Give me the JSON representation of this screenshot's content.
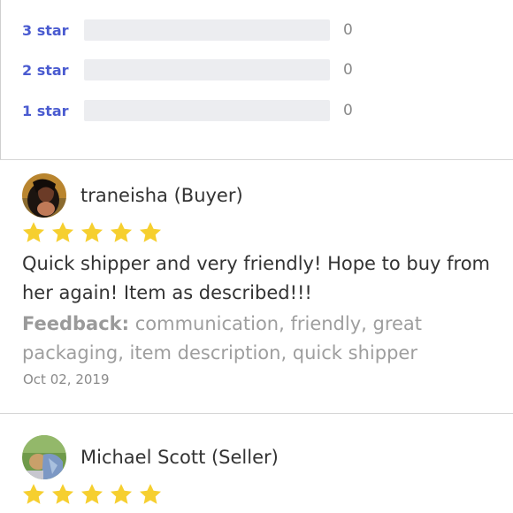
{
  "rating_breakdown": [
    {
      "label": "3 star",
      "count": "0",
      "fraction": 0
    },
    {
      "label": "2 star",
      "count": "0",
      "fraction": 0
    },
    {
      "label": "1 star",
      "count": "0",
      "fraction": 0
    }
  ],
  "reviews": [
    {
      "reviewer": "traneisha (Buyer)",
      "rating": 5,
      "text": "Quick shipper and very friendly! Hope to buy from her again! Item as described!!!",
      "feedback_label": "Feedback:",
      "feedback": "communication, friendly, great packaging, item description, quick shipper",
      "date": "Oct 02, 2019"
    },
    {
      "reviewer": "Michael Scott (Seller)",
      "rating": 5
    }
  ],
  "colors": {
    "accent": "#4a5bd0",
    "star": "#f6cf2f",
    "bar_track": "#ecedf0"
  }
}
